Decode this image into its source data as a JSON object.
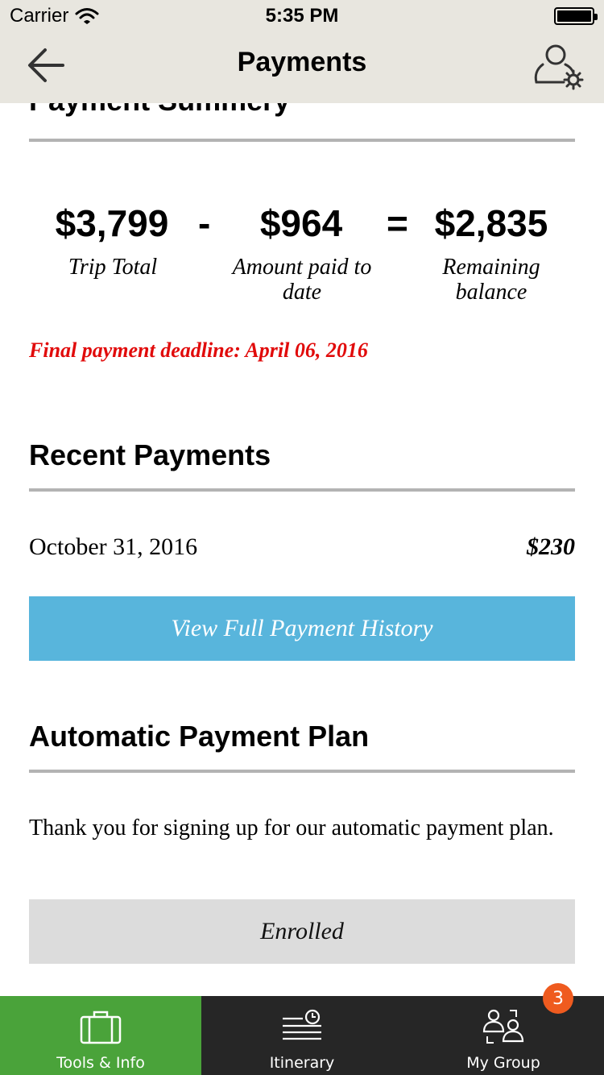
{
  "status_bar": {
    "carrier": "Carrier",
    "time": "5:35 PM"
  },
  "nav": {
    "title": "Payments",
    "back_icon": "arrow-left-icon",
    "profile_icon": "user-settings-icon"
  },
  "summary": {
    "title": "Payment Summery",
    "trip_total": {
      "amount": "$3,799",
      "label": "Trip Total"
    },
    "minus": "-",
    "paid": {
      "amount": "$964",
      "label": "Amount paid to date"
    },
    "equals": "=",
    "remaining": {
      "amount": "$2,835",
      "label": "Remaining balance"
    },
    "deadline": "Final payment deadline: April 06, 2016",
    "deadline_color": "#e10b0b"
  },
  "recent": {
    "title": "Recent Payments",
    "payments": [
      {
        "date": "October 31, 2016",
        "amount": "$230"
      }
    ],
    "history_button": "View Full Payment History",
    "history_button_color": "#58b5dc"
  },
  "auto_plan": {
    "title": "Automatic Payment Plan",
    "message": "Thank you for signing up for our automatic payment plan.",
    "status_button": "Enrolled"
  },
  "tabbar": {
    "tabs": [
      {
        "label": "Tools & Info",
        "icon": "briefcase-icon",
        "active": true
      },
      {
        "label": "Itinerary",
        "icon": "itinerary-clock-icon",
        "active": false
      },
      {
        "label": "My Group",
        "icon": "group-icon",
        "active": false
      }
    ],
    "badge": "3",
    "active_color": "#4aa33a",
    "badge_color": "#ef5b1f"
  }
}
